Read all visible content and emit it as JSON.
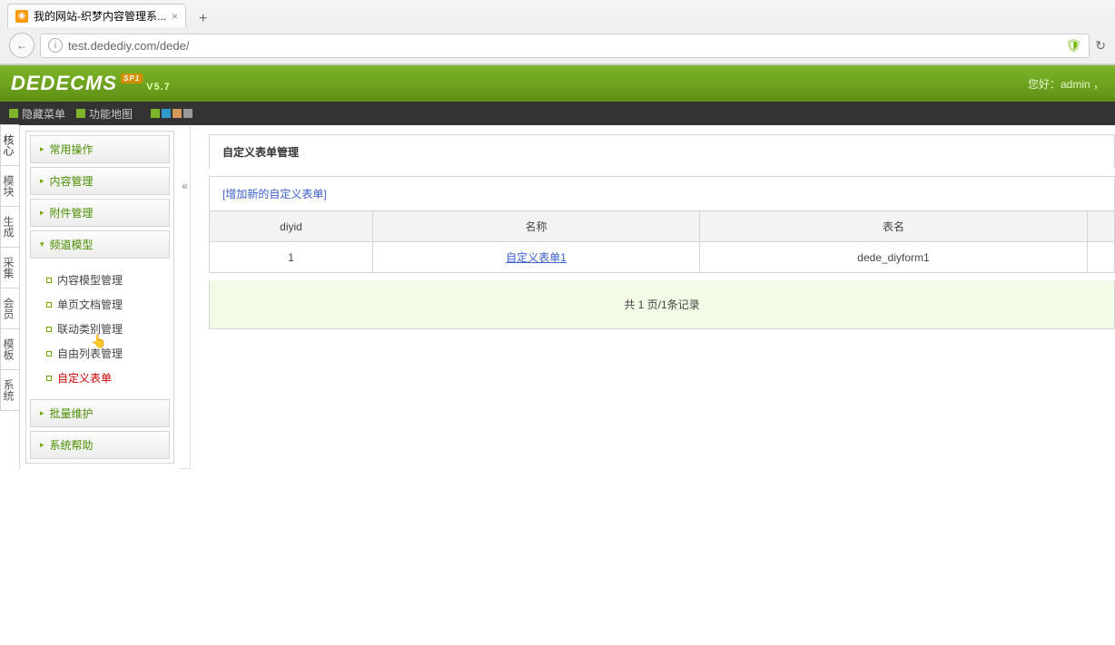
{
  "browser": {
    "tab_title": "我的网站-织梦内容管理系...",
    "url": "test.dedediy.com/dede/"
  },
  "header": {
    "logo_text": "DEDECMS",
    "version": "V5.7",
    "sp_label": "SP1",
    "greeting": "您好：admin ，"
  },
  "topmenu": {
    "hide_menu": "隐藏菜单",
    "sitemap": "功能地图",
    "colors": [
      "#7eb52a",
      "#3399cc",
      "#d4985b",
      "#999999"
    ]
  },
  "side_tabs": [
    "核心",
    "模块",
    "生成",
    "采集",
    "会员",
    "模板",
    "系统"
  ],
  "sidebar": {
    "sections": [
      {
        "label": "常用操作",
        "expanded": false
      },
      {
        "label": "内容管理",
        "expanded": false
      },
      {
        "label": "附件管理",
        "expanded": false
      },
      {
        "label": "频道模型",
        "expanded": true,
        "items": [
          {
            "label": "内容模型管理",
            "current": false
          },
          {
            "label": "单页文档管理",
            "current": false
          },
          {
            "label": "联动类别管理",
            "current": false
          },
          {
            "label": "自由列表管理",
            "current": false
          },
          {
            "label": "自定义表单",
            "current": true
          }
        ]
      },
      {
        "label": "批量维护",
        "expanded": false
      },
      {
        "label": "系统帮助",
        "expanded": false
      }
    ]
  },
  "main": {
    "panel_title": "自定义表单管理",
    "add_link": "[增加新的自定义表单]",
    "columns": {
      "id": "diyid",
      "name": "名称",
      "table": "表名"
    },
    "rows": [
      {
        "id": "1",
        "name": "自定义表单1",
        "table": "dede_diyform1"
      }
    ],
    "pager": "共 1 页/1条记录"
  }
}
